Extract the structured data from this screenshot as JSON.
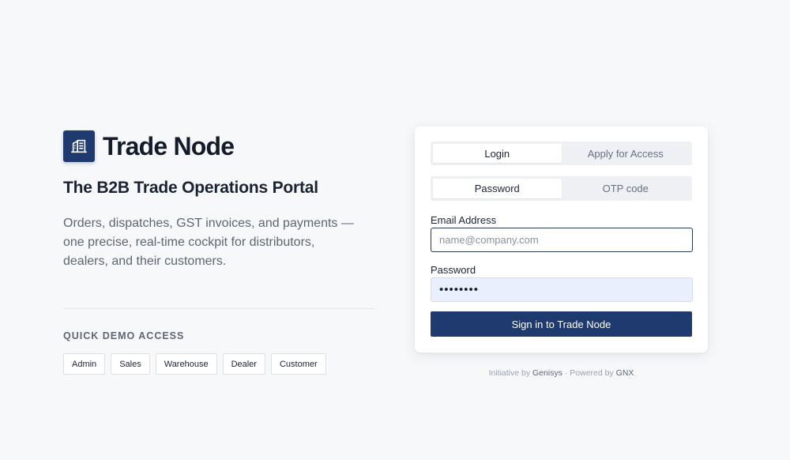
{
  "brand": {
    "name": "Trade Node",
    "logo_icon": "building-icon",
    "logo_color": "#1e3a6e"
  },
  "tagline": "The B2B Trade Operations Portal",
  "description": "Orders, dispatches, GST invoices, and payments — one precise, real-time cockpit for distributors, dealers, and their customers.",
  "demo": {
    "heading": "QUICK DEMO ACCESS",
    "roles": [
      "Admin",
      "Sales",
      "Warehouse",
      "Dealer",
      "Customer"
    ]
  },
  "card": {
    "top_tabs": {
      "login": "Login",
      "apply": "Apply for Access",
      "active": "login"
    },
    "method_tabs": {
      "password": "Password",
      "otp": "OTP code",
      "active": "password"
    },
    "email": {
      "label": "Email Address",
      "placeholder": "name@company.com",
      "value": ""
    },
    "password": {
      "label": "Password",
      "value": "••••••••"
    },
    "submit_label": "Sign in to Trade Node"
  },
  "footer": {
    "initiative_prefix": "Initiative by",
    "initiative_org": "Genisys",
    "separator": "·",
    "powered_prefix": "Powered by",
    "powered_org": "GNX"
  },
  "colors": {
    "accent": "#1e3a6e",
    "background": "#f7f8fa",
    "autofill": "#e9effc"
  }
}
